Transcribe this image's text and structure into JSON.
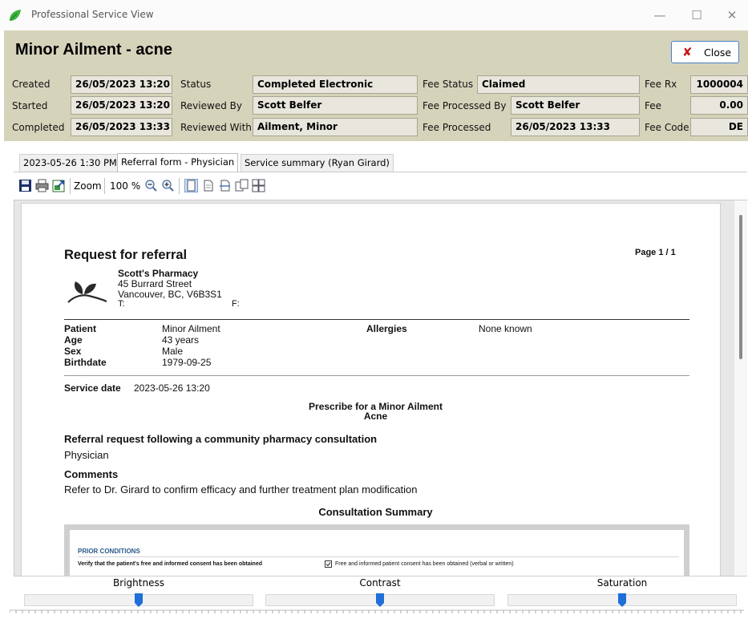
{
  "window": {
    "title": "Professional Service View",
    "buttons": {
      "minimize": "—",
      "maximize": "☐",
      "close": "✕"
    }
  },
  "header": {
    "title": "Minor Ailment - acne",
    "close_label": "Close",
    "created": {
      "label": "Created",
      "value": "26/05/2023 13:20"
    },
    "started": {
      "label": "Started",
      "value": "26/05/2023 13:20"
    },
    "completed": {
      "label": "Completed",
      "value": "26/05/2023 13:33"
    },
    "status": {
      "label": "Status",
      "value": "Completed Electronic"
    },
    "reviewed_by": {
      "label": "Reviewed By",
      "value": "Scott Belfer"
    },
    "reviewed_with": {
      "label": "Reviewed With",
      "value": "Ailment, Minor"
    },
    "fee_status": {
      "label": "Fee Status",
      "value": "Claimed"
    },
    "fee_processed_by": {
      "label": "Fee Processed By",
      "value": "Scott Belfer"
    },
    "fee_processed": {
      "label": "Fee Processed",
      "value": "26/05/2023 13:33"
    },
    "fee_rx": {
      "label": "Fee Rx",
      "value": "1000004"
    },
    "fee": {
      "label": "Fee",
      "value": "0.00"
    },
    "fee_code": {
      "label": "Fee Code",
      "value": "DE"
    }
  },
  "tabs": [
    {
      "label": "2023-05-26 1:30 PM",
      "active": false
    },
    {
      "label": "Referral form - Physician",
      "active": true
    },
    {
      "label": "Service summary (Ryan Girard)",
      "active": false
    }
  ],
  "toolbar": {
    "zoom_label": "Zoom",
    "zoom_value": "100",
    "zoom_unit": "%"
  },
  "document": {
    "title": "Request for referral",
    "page": "Page 1 / 1",
    "pharmacy": {
      "name": "Scott's Pharmacy",
      "address1": "45 Burrard Street",
      "address2": "Vancouver, BC, V6B3S1",
      "tel_label": "T:",
      "fax_label": "F:"
    },
    "patient": {
      "patient_label": "Patient",
      "patient_value": "Minor Ailment",
      "age_label": "Age",
      "age_value": "43 years",
      "sex_label": "Sex",
      "sex_value": "Male",
      "birth_label": "Birthdate",
      "birth_value": "1979-09-25",
      "allergies_label": "Allergies",
      "allergies_value": "None known"
    },
    "service_date_label": "Service date",
    "service_date_value": "2023-05-26 13:20",
    "prescribe_title": "Prescribe for a Minor Ailment",
    "prescribe_sub": "Acne",
    "referral_heading": "Referral request following a community pharmacy consultation",
    "referral_to": "Physician",
    "comments_heading": "Comments",
    "comments": "Refer to Dr. Girard to confirm efficacy and further treatment plan modification",
    "consultation_heading": "Consultation Summary",
    "prior_conditions": "PRIOR CONDITIONS",
    "consent_question": "Verify that the patient's free and informed consent has been obtained",
    "consent_answer": "Free and informed patient consent has been obtained (verbal or written)"
  },
  "adjusters": [
    {
      "label": "Brightness",
      "level": 0.5
    },
    {
      "label": "Contrast",
      "level": 0.5
    },
    {
      "label": "Saturation",
      "level": 0.5
    }
  ],
  "colors": {
    "header_bg": "#d6d3bb",
    "value_box_bg": "#e8e6dd",
    "accent_blue": "#1e6fd9",
    "close_icon": "#c41a1a",
    "section_blue": "#2a5a8a"
  }
}
